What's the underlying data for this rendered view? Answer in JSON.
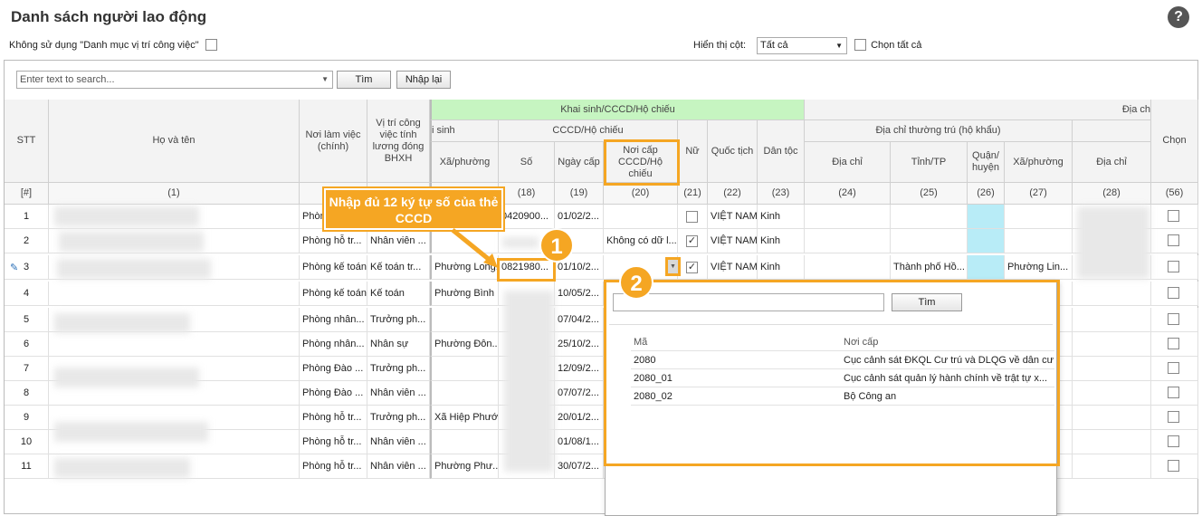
{
  "title": "Danh sách người lao động",
  "toolbar": {
    "use_position_label": "Không sử dụng \"Danh mục vị trí công việc\"",
    "show_columns_label": "Hiển thị cột:",
    "show_columns_value": "Tất cả",
    "select_all_label": "Chọn tất cả"
  },
  "search": {
    "placeholder": "Enter text to search...",
    "find_label": "Tìm",
    "reset_label": "Nhập lại"
  },
  "headers": {
    "stt": "STT",
    "name": "Họ và tên",
    "workplace": "Nơi làm việc (chính)",
    "position": "Vị trí công việc tính lương đóng BHXH",
    "birth_group": "Khai sinh/CCCD/Hộ chiếu",
    "birth_sub": "i sinh",
    "birth_ward": "Xã/phường",
    "cccd_group": "CCCD/Hộ chiếu",
    "cccd_no": "Số",
    "cccd_date": "Ngày cấp",
    "cccd_place": "Nơi cấp CCCD/Hộ chiếu",
    "female": "Nữ",
    "nationality": "Quốc tịch",
    "ethnicity": "Dân tộc",
    "address_group": "Địa ch",
    "perm_group": "Địa chỉ thường trú (hộ khẩu)",
    "perm_addr": "Địa chỉ",
    "perm_city": "Tỉnh/TP",
    "perm_district": "Quận/ huyện",
    "perm_ward": "Xã/phường",
    "addr2": "Địa chỉ",
    "choose": "Chọn"
  },
  "col_numbers": [
    "[#]",
    "(1)",
    "(18)",
    "(19)",
    "(20)",
    "(21)",
    "(22)",
    "(23)",
    "(24)",
    "(25)",
    "(26)",
    "(27)",
    "(28)",
    "(56)"
  ],
  "rows": [
    {
      "stt": "1",
      "workplace": "Phòng",
      "position": "",
      "ward": "",
      "no": "0420900...",
      "date": "01/02/2...",
      "place": "",
      "female": false,
      "nat": "VIỆT NAM",
      "eth": "Kinh",
      "city": "",
      "pward": ""
    },
    {
      "stt": "2",
      "workplace": "Phòng hỗ tr...",
      "position": "Nhân viên ...",
      "ward": "",
      "no": "",
      "date": "",
      "place": "Không có dữ l...",
      "female": true,
      "nat": "VIỆT NAM",
      "eth": "Kinh",
      "city": "",
      "pward": ""
    },
    {
      "stt": "3",
      "workplace": "Phòng kế toán",
      "position": "Kế toán tr...",
      "ward": "Phường Long...",
      "no": "0821980...",
      "date": "01/10/2...",
      "place": "",
      "female": true,
      "nat": "VIỆT NAM",
      "eth": "Kinh",
      "city": "Thành phố Hồ...",
      "pward": "Phường Lin..."
    },
    {
      "stt": "4",
      "workplace": "Phòng kế toán",
      "position": "Kế toán",
      "ward": "Phường Bình ...",
      "no": "",
      "date": "10/05/2...",
      "place": "",
      "female": false,
      "nat": "",
      "eth": "",
      "city": "",
      "pward": ""
    },
    {
      "stt": "5",
      "workplace": "Phòng nhân...",
      "position": "Trưởng ph...",
      "ward": "",
      "no": "",
      "date": "07/04/2...",
      "place": "",
      "female": false,
      "nat": "",
      "eth": "",
      "city": "",
      "pward": ""
    },
    {
      "stt": "6",
      "workplace": "Phòng nhân...",
      "position": "Nhân sự",
      "ward": "Phường Đôn...",
      "no": "",
      "date": "25/10/2...",
      "place": "",
      "female": false,
      "nat": "",
      "eth": "",
      "city": "",
      "pward": ""
    },
    {
      "stt": "7",
      "workplace": "Phòng Đào ...",
      "position": "Trưởng ph...",
      "ward": "",
      "no": "",
      "date": "12/09/2...",
      "place": "",
      "female": false,
      "nat": "",
      "eth": "",
      "city": "",
      "pward": ""
    },
    {
      "stt": "8",
      "workplace": "Phòng Đào ...",
      "position": "Nhân viên ...",
      "ward": "",
      "no": "",
      "date": "07/07/2...",
      "place": "",
      "female": false,
      "nat": "",
      "eth": "",
      "city": "",
      "pward": ""
    },
    {
      "stt": "9",
      "workplace": "Phòng hỗ tr...",
      "position": "Trưởng ph...",
      "ward": "Xã Hiệp Phước",
      "no": "",
      "date": "20/01/2...",
      "place": "",
      "female": false,
      "nat": "",
      "eth": "",
      "city": "",
      "pward": ""
    },
    {
      "stt": "10",
      "workplace": "Phòng hỗ tr...",
      "position": "Nhân viên ...",
      "ward": "",
      "no": "",
      "date": "01/08/1...",
      "place": "",
      "female": false,
      "nat": "",
      "eth": "",
      "city": "",
      "pward": ""
    },
    {
      "stt": "11",
      "workplace": "Phòng hỗ tr...",
      "position": "Nhân viên ...",
      "ward": "Phường Phư...",
      "no": "",
      "date": "30/07/2...",
      "place": "",
      "female": false,
      "nat": "",
      "eth": "",
      "city": "",
      "pward": ""
    }
  ],
  "dropdown": {
    "find_label": "Tìm",
    "col_code": "Mã",
    "col_place": "Nơi cấp",
    "items": [
      {
        "code": "2080",
        "place": "Cục cảnh sát ĐKQL Cư trú và DLQG về dân cư"
      },
      {
        "code": "2080_01",
        "place": "Cục cảnh sát quản lý hành chính về trật tự x..."
      },
      {
        "code": "2080_02",
        "place": "Bộ Công an"
      }
    ]
  },
  "callouts": {
    "step1_text": "Nhập đủ 12 ký tự số của thẻ CCCD",
    "step1_num": "1",
    "step2_num": "2"
  },
  "colors": {
    "accent": "#f5a623",
    "group_green": "#c6f5c1",
    "highlight_cyan": "#b8ecf7"
  }
}
